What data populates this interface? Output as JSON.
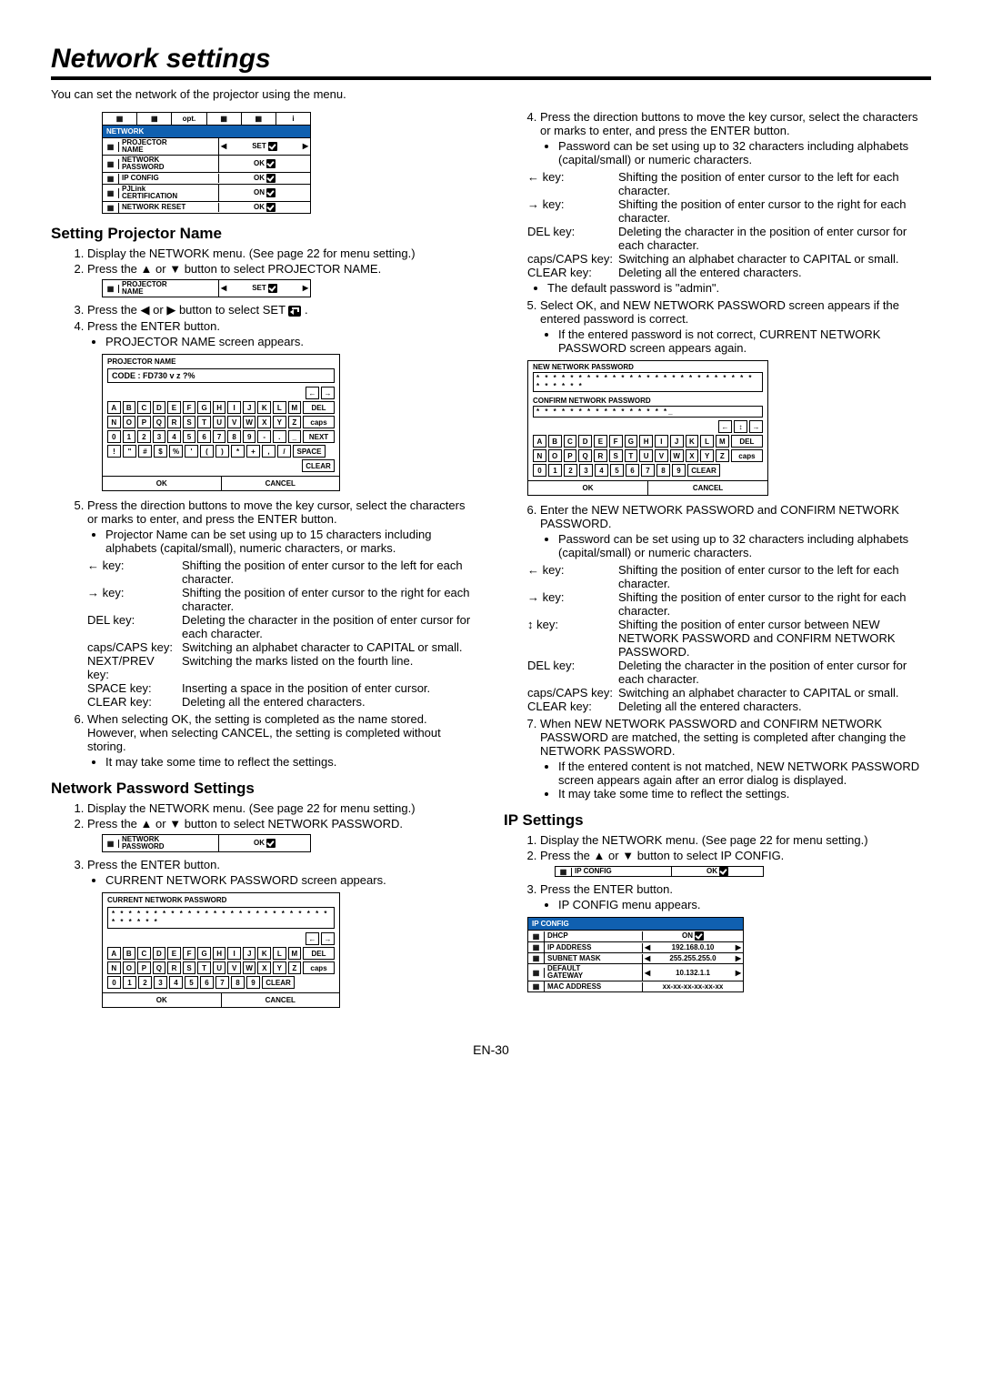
{
  "page": {
    "title": "Network settings",
    "intro": "You can set the network of the projector using the menu.",
    "page_num": "EN-30"
  },
  "network_menu": {
    "tabs": [
      "⬚",
      "⬚",
      "opt.",
      "⬚",
      "⬚",
      "i"
    ],
    "header": "NETWORK",
    "rows": [
      {
        "label_l1": "PROJECTOR",
        "label_l2": "NAME",
        "val": "SET",
        "arrows": true,
        "check": true
      },
      {
        "label_l1": "NETWORK",
        "label_l2": "PASSWORD",
        "val": "OK",
        "arrows": false,
        "check": true
      },
      {
        "label_l1": "IP CONFIG",
        "label_l2": "",
        "val": "OK",
        "arrows": false,
        "check": true
      },
      {
        "label_l1": "PJLink",
        "label_l2": "CERTIFICATION",
        "val": "ON",
        "arrows": false,
        "check": true
      },
      {
        "label_l1": "NETWORK RESET",
        "label_l2": "",
        "val": "OK",
        "arrows": false,
        "check": true
      }
    ]
  },
  "sec1": {
    "title": "Setting Projector Name",
    "s1": "Display the NETWORK menu. (See page 22 for menu setting.)",
    "s2a": "Press the ",
    "s2b": " or ",
    "s2c": " button to select PROJECTOR NAME.",
    "mini": {
      "label_l1": "PROJECTOR",
      "label_l2": "NAME",
      "val": "SET"
    },
    "s3a": "Press the ",
    "s3b": " or ",
    "s3c": " button to select SET ",
    "s3d": " .",
    "s4": "Press the ENTER button.",
    "s4b": "PROJECTOR NAME screen appears.",
    "osk": {
      "title": "PROJECTOR NAME",
      "input": "CODE : FD730      v z ?%",
      "row1": [
        "A",
        "B",
        "C",
        "D",
        "E",
        "F",
        "G",
        "H",
        "I",
        "J",
        "K",
        "L",
        "M"
      ],
      "row2": [
        "N",
        "O",
        "P",
        "Q",
        "R",
        "S",
        "T",
        "U",
        "V",
        "W",
        "X",
        "Y",
        "Z"
      ],
      "row3": [
        "0",
        "1",
        "2",
        "3",
        "4",
        "5",
        "6",
        "7",
        "8",
        "9",
        "-",
        ".",
        "_"
      ],
      "row4": [
        "!",
        "\"",
        "#",
        "$",
        "%",
        "'",
        "(",
        ")",
        "*",
        "+",
        ",",
        "/"
      ],
      "side": [
        "←",
        "→",
        "DEL",
        "caps",
        "NEXT",
        "SPACE",
        "CLEAR"
      ],
      "ok": "OK",
      "cancel": "CANCEL"
    },
    "s5": "Press the direction buttons to move the key cursor, select the characters or marks to enter, and press the ENTER button.",
    "s5a": "Projector Name can be set using up to 15 characters including alphabets (capital/small), numeric characters, or marks.",
    "kv": [
      {
        "k": "← key:",
        "v": "Shifting the position of enter cursor to the left for each character."
      },
      {
        "k": "→ key:",
        "v": "Shifting the position of enter cursor to the right for each character."
      },
      {
        "k": "DEL key:",
        "v": "Deleting the character in the position of enter cursor for each character."
      },
      {
        "k": "caps/CAPS key:",
        "v": "Switching an alphabet character to CAPITAL or small."
      },
      {
        "k": "NEXT/PREV key:",
        "v": "Switching the marks listed on the fourth line."
      },
      {
        "k": "SPACE key:",
        "v": "Inserting a space in the position of enter cursor."
      },
      {
        "k": "CLEAR key:",
        "v": "Deleting all the entered characters."
      }
    ],
    "s6": "When selecting OK, the setting is completed as the name stored. However, when selecting CANCEL, the setting is completed without storing.",
    "s6b": "It may take some time to reflect the settings."
  },
  "sec2": {
    "title": "Network Password Settings",
    "s1": "Display the NETWORK menu. (See page 22 for menu setting.)",
    "s2a": "Press the ",
    "s2b": " or ",
    "s2c": " button to select NETWORK PASSWORD.",
    "mini": {
      "label_l1": "NETWORK",
      "label_l2": "PASSWORD",
      "val": "OK"
    },
    "s3": "Press the ENTER button.",
    "s3b": "CURRENT NETWORK PASSWORD screen appears.",
    "osk": {
      "title": "CURRENT NETWORK PASSWORD",
      "input": "* * * * * * * * * * * * * * * * * * * * * * * * * * * * * * * *",
      "row1": [
        "A",
        "B",
        "C",
        "D",
        "E",
        "F",
        "G",
        "H",
        "I",
        "J",
        "K",
        "L",
        "M"
      ],
      "row2": [
        "N",
        "O",
        "P",
        "Q",
        "R",
        "S",
        "T",
        "U",
        "V",
        "W",
        "X",
        "Y",
        "Z"
      ],
      "row3": [
        "0",
        "1",
        "2",
        "3",
        "4",
        "5",
        "6",
        "7",
        "8",
        "9"
      ],
      "side": [
        "←",
        "→",
        "DEL",
        "caps",
        "CLEAR"
      ],
      "ok": "OK",
      "cancel": "CANCEL"
    }
  },
  "right": {
    "s4": "Press the direction buttons to move the key cursor, select the characters or marks to enter, and press the ENTER button.",
    "s4a": "Password can be set using up to 32 characters including alphabets (capital/small) or numeric characters.",
    "kv4": [
      {
        "k": "← key:",
        "v": "Shifting the position of enter cursor to the left for each character."
      },
      {
        "k": "→ key:",
        "v": "Shifting the position of enter cursor to the right for each character."
      },
      {
        "k": "DEL key:",
        "v": "Deleting the character in the position of enter cursor for each character."
      },
      {
        "k": "caps/CAPS key:",
        "v": "Switching an alphabet character to CAPITAL or small."
      },
      {
        "k": "CLEAR key:",
        "v": "Deleting all the entered characters."
      }
    ],
    "s4b": "The default password is \"admin\".",
    "s5": "Select OK, and NEW NETWORK PASSWORD screen appears if the entered password is correct.",
    "s5a": "If the entered password is not correct, CURRENT NETWORK PASSWORD screen appears again.",
    "osk2": {
      "t1": "NEW NETWORK PASSWORD",
      "i1": "* * * * * * * * * * * * * * * * * * * * * * * * * * * * * * * *",
      "t2": "CONFIRM NETWORK PASSWORD",
      "i2": "* * * * * * * * * * * * * * * *_",
      "row1": [
        "A",
        "B",
        "C",
        "D",
        "E",
        "F",
        "G",
        "H",
        "I",
        "J",
        "K",
        "L",
        "M"
      ],
      "row2": [
        "N",
        "O",
        "P",
        "Q",
        "R",
        "S",
        "T",
        "U",
        "V",
        "W",
        "X",
        "Y",
        "Z"
      ],
      "row3": [
        "0",
        "1",
        "2",
        "3",
        "4",
        "5",
        "6",
        "7",
        "8",
        "9"
      ],
      "side": [
        "←",
        "↕",
        "→",
        "DEL",
        "caps",
        "CLEAR"
      ],
      "ok": "OK",
      "cancel": "CANCEL"
    },
    "s6": "Enter the NEW NETWORK PASSWORD and CONFIRM NETWORK PASSWORD.",
    "s6a": "Password can be set using up to 32 characters including alphabets (capital/small) or numeric characters.",
    "kv6": [
      {
        "k": "← key:",
        "v": "Shifting the position of enter cursor to the left for each character."
      },
      {
        "k": "→ key:",
        "v": "Shifting the position of enter cursor to the right for each character."
      },
      {
        "k": "↕ key:",
        "v": "Shifting the position of enter cursor between NEW NETWORK PASSWORD and CONFIRM NETWORK PASSWORD."
      },
      {
        "k": "DEL key:",
        "v": "Deleting the character in the position of enter cursor for each character."
      },
      {
        "k": "caps/CAPS key:",
        "v": "Switching an alphabet character to CAPITAL or small."
      },
      {
        "k": "CLEAR key:",
        "v": "Deleting all the entered characters."
      }
    ],
    "s7": "When NEW NETWORK PASSWORD and CONFIRM NETWORK PASSWORD are matched, the setting is completed after changing the NETWORK PASSWORD.",
    "s7a": "If the entered content is not matched, NEW NETWORK PASSWORD screen appears again after an error dialog is displayed.",
    "s7b": "It may take some time to reflect the settings."
  },
  "sec3": {
    "title": "IP Settings",
    "s1": "Display the NETWORK menu. (See page 22 for menu setting.)",
    "s2a": "Press the ",
    "s2b": " or ",
    "s2c": " button to select IP CONFIG.",
    "mini": {
      "label": "IP CONFIG",
      "val": "OK"
    },
    "s3": "Press the ENTER button.",
    "s3b": "IP CONFIG menu appears.",
    "ipbox": {
      "header": "IP CONFIG",
      "rows": [
        {
          "label": "DHCP",
          "val": "ON",
          "arrows": false,
          "check": true
        },
        {
          "label": "IP ADDRESS",
          "val": "192.168.0.10",
          "arrows": true
        },
        {
          "label": "SUBNET MASK",
          "val": "255.255.255.0",
          "arrows": true
        },
        {
          "label": "DEFAULT GATEWAY",
          "val": "10.132.1.1",
          "arrows": true
        },
        {
          "label": "MAC ADDRESS",
          "val": "xx-xx-xx-xx-xx-xx",
          "arrows": false
        }
      ]
    }
  }
}
